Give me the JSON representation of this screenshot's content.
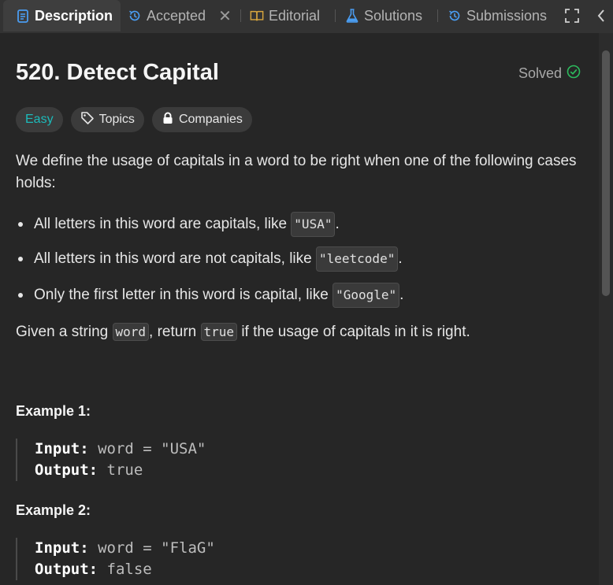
{
  "tabs": [
    {
      "label": "Description",
      "icon": "description-icon"
    },
    {
      "label": "Accepted",
      "icon": "history-icon"
    },
    {
      "label": "Editorial",
      "icon": "book-icon"
    },
    {
      "label": "Solutions",
      "icon": "flask-icon"
    },
    {
      "label": "Submissions",
      "icon": "history-icon"
    }
  ],
  "problem": {
    "title": "520. Detect Capital",
    "status": "Solved",
    "difficulty": "Easy",
    "tags": [
      "Topics",
      "Companies"
    ],
    "intro": "We define the usage of capitals in a word to be right when one of the following cases holds:",
    "cases": [
      {
        "text": "All letters in this word are capitals, like ",
        "code": "\"USA\"",
        "end": "."
      },
      {
        "text": "All letters in this word are not capitals, like ",
        "code": "\"leetcode\"",
        "end": "."
      },
      {
        "text": "Only the first letter in this word is capital, like ",
        "code": "\"Google\"",
        "end": "."
      }
    ],
    "task": {
      "p1": "Given a string ",
      "c1": "word",
      "p2": ", return ",
      "c2": "true",
      "p3": " if the usage of capitals in it is right."
    },
    "examples": [
      {
        "title": "Example 1:",
        "input_label": "Input:",
        "input": "word = \"USA\"",
        "output_label": "Output:",
        "output": "true"
      },
      {
        "title": "Example 2:",
        "input_label": "Input:",
        "input": "word = \"FlaG\"",
        "output_label": "Output:",
        "output": "false"
      }
    ]
  },
  "colors": {
    "easy": "#1cbaba",
    "solved_check": "#2cbb5d",
    "active_tab_icon": "#4a9cf0",
    "editorial_icon": "#d8a63e",
    "solutions_icon": "#4a9cf0"
  }
}
